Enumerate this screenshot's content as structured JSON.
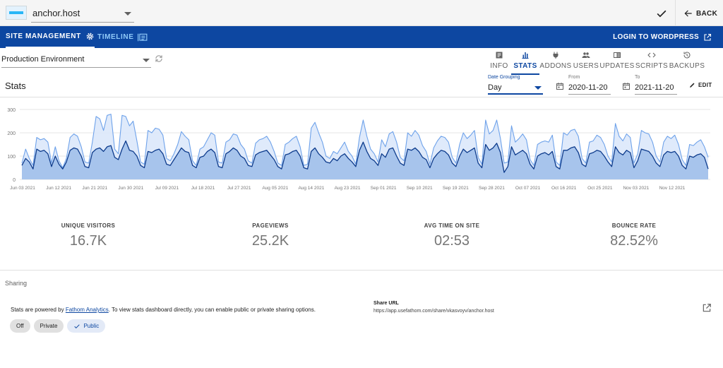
{
  "topbar": {
    "site_name": "anchor.host",
    "back_label": "BACK"
  },
  "nav": {
    "site_management": "SITE MANAGEMENT",
    "timeline": "TIMELINE",
    "login": "LOGIN TO WORDPRESS"
  },
  "environment": {
    "selected": "Production Environment"
  },
  "tabs": [
    {
      "label": "INFO",
      "icon": "info-icon"
    },
    {
      "label": "STATS",
      "icon": "bar-chart-icon",
      "active": true
    },
    {
      "label": "ADDONS",
      "icon": "plug-icon"
    },
    {
      "label": "USERS",
      "icon": "users-icon"
    },
    {
      "label": "UPDATES",
      "icon": "updates-icon"
    },
    {
      "label": "SCRIPTS",
      "icon": "code-icon"
    },
    {
      "label": "BACKUPS",
      "icon": "history-icon"
    }
  ],
  "stats": {
    "title": "Stats",
    "grouping_label": "Date Grouping",
    "grouping_value": "Day",
    "from_label": "From",
    "from_value": "2020-11-20",
    "to_label": "To",
    "to_value": "2021-11-20",
    "edit_label": "EDIT"
  },
  "chart_data": {
    "type": "area",
    "title": "",
    "xlabel": "",
    "ylabel": "",
    "ylim": [
      0,
      300
    ],
    "y_ticks": [
      0,
      100,
      200,
      300
    ],
    "x_ticks": [
      "Jun 03 2021",
      "Jun 12 2021",
      "Jun 21 2021",
      "Jun 30 2021",
      "Jul 09 2021",
      "Jul 18 2021",
      "Jul 27 2021",
      "Aug 05 2021",
      "Aug 14 2021",
      "Aug 23 2021",
      "Sep 01 2021",
      "Sep 10 2021",
      "Sep 19 2021",
      "Sep 28 2021",
      "Oct 07 2021",
      "Oct 16 2021",
      "Oct 25 2021",
      "Nov 03 2021",
      "Nov 12 2021"
    ],
    "grid": true,
    "legend": "none",
    "colors": {
      "pageviews_line": "#6ea2ea",
      "pageviews_fill": "#dbe8fb",
      "visitors_line": "#0d3b8c",
      "visitors_fill": "#9ebde9"
    },
    "series": [
      {
        "values": [
          70,
          130,
          90,
          60,
          180,
          170,
          175,
          160,
          70,
          140,
          80,
          50,
          90,
          180,
          195,
          185,
          140,
          75,
          70,
          160,
          270,
          260,
          210,
          275,
          280,
          130,
          110,
          275,
          270,
          230,
          250,
          165,
          75,
          65,
          210,
          200,
          220,
          215,
          190,
          90,
          80,
          110,
          150,
          205,
          185,
          170,
          80,
          60,
          130,
          140,
          170,
          200,
          190,
          75,
          70,
          160,
          170,
          195,
          190,
          150,
          130,
          80,
          70,
          155,
          170,
          175,
          185,
          160,
          120,
          70,
          60,
          150,
          160,
          175,
          185,
          140,
          60,
          65,
          220,
          245,
          200,
          160,
          100,
          90,
          120,
          110,
          135,
          160,
          120,
          100,
          65,
          180,
          255,
          185,
          130,
          110,
          75,
          170,
          140,
          195,
          205,
          160,
          95,
          80,
          200,
          185,
          210,
          190,
          145,
          120,
          65,
          135,
          165,
          185,
          180,
          160,
          95,
          70,
          150,
          200,
          175,
          190,
          210,
          95,
          65,
          255,
          195,
          210,
          255,
          175,
          70,
          75,
          230,
          160,
          175,
          195,
          170,
          85,
          60,
          150,
          160,
          165,
          160,
          190,
          75,
          60,
          200,
          190,
          210,
          215,
          185,
          90,
          70,
          160,
          165,
          190,
          180,
          150,
          100,
          75,
          240,
          185,
          165,
          195,
          180,
          70,
          110,
          210,
          200,
          195,
          160,
          100,
          75,
          160,
          185,
          175,
          190,
          150,
          85,
          60,
          150,
          145,
          160,
          170,
          140,
          95
        ]
      },
      {
        "values": [
          60,
          90,
          75,
          45,
          130,
          120,
          125,
          110,
          55,
          100,
          65,
          45,
          75,
          125,
          135,
          130,
          100,
          55,
          50,
          115,
          130,
          135,
          120,
          140,
          145,
          95,
          85,
          130,
          165,
          125,
          120,
          100,
          60,
          50,
          120,
          115,
          125,
          130,
          110,
          65,
          60,
          85,
          110,
          135,
          120,
          115,
          60,
          50,
          95,
          100,
          120,
          130,
          115,
          55,
          50,
          110,
          120,
          135,
          125,
          100,
          90,
          60,
          55,
          105,
          115,
          120,
          125,
          105,
          85,
          55,
          45,
          105,
          110,
          120,
          125,
          100,
          50,
          45,
          120,
          135,
          110,
          95,
          75,
          70,
          90,
          80,
          100,
          110,
          90,
          75,
          55,
          125,
          160,
          120,
          90,
          80,
          60,
          110,
          95,
          130,
          135,
          100,
          70,
          60,
          130,
          125,
          135,
          120,
          95,
          85,
          50,
          90,
          110,
          125,
          120,
          105,
          70,
          55,
          100,
          130,
          115,
          125,
          135,
          70,
          50,
          150,
          125,
          135,
          155,
          115,
          30,
          55,
          140,
          105,
          115,
          125,
          110,
          65,
          45,
          100,
          110,
          115,
          105,
          120,
          55,
          45,
          125,
          125,
          135,
          140,
          115,
          65,
          55,
          110,
          115,
          125,
          120,
          100,
          75,
          55,
          140,
          115,
          105,
          125,
          115,
          50,
          80,
          130,
          125,
          120,
          100,
          70,
          55,
          105,
          120,
          115,
          120,
          100,
          60,
          45,
          100,
          95,
          105,
          110,
          95,
          45
        ]
      }
    ]
  },
  "metrics": [
    {
      "label": "UNIQUE VISITORS",
      "value": "16.7K"
    },
    {
      "label": "PAGEVIEWS",
      "value": "25.2K"
    },
    {
      "label": "AVG TIME ON SITE",
      "value": "02:53"
    },
    {
      "label": "BOUNCE RATE",
      "value": "82.52%"
    }
  ],
  "sharing": {
    "title": "Sharing",
    "text_before": "Stats are powered by ",
    "link": "Fathom Analytics",
    "text_after": ". To view stats dashboard directly, you can enable public or private sharing options.",
    "options": [
      "Off",
      "Private",
      "Public"
    ],
    "selected": "Public",
    "share_url_label": "Share URL",
    "share_url": "https://app.usefathom.com/share/vkasvoyv/anchor.host"
  }
}
